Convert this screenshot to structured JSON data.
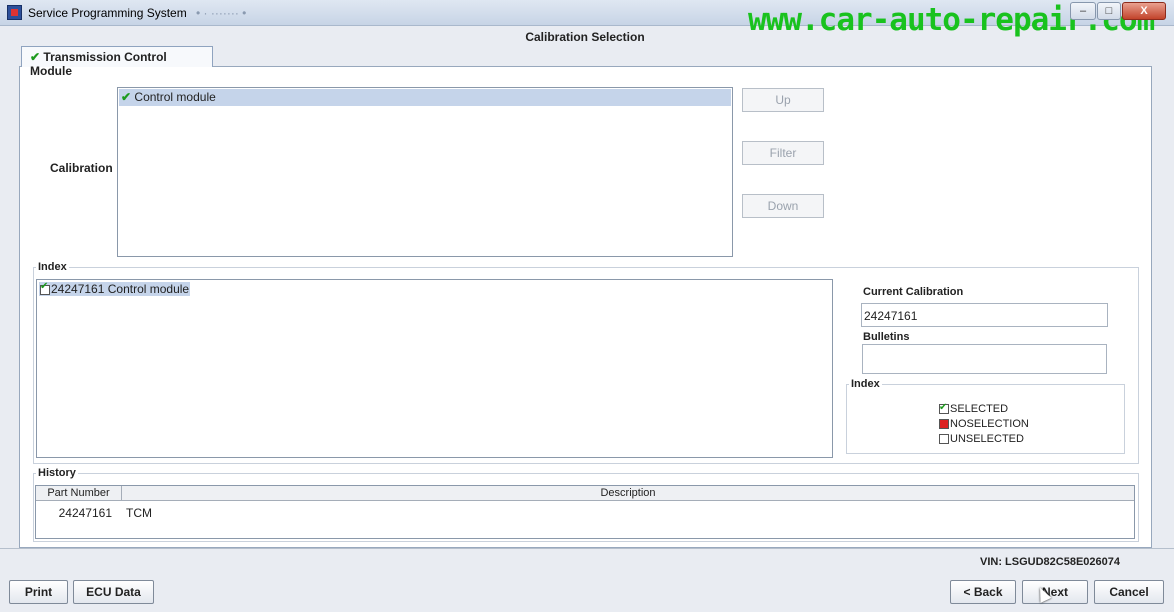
{
  "window": {
    "title": "Service Programming System",
    "ghost_title": "• · ······· •",
    "watermark": "www.car-auto-repair.com",
    "minimize_glyph": "–",
    "maximize_glyph": "□",
    "close_glyph": "X"
  },
  "header": {
    "title": "Calibration Selection",
    "tab_check": "✔",
    "tab_label": "Transmission Control Module"
  },
  "calibration": {
    "label": "Calibration",
    "item_check": "✔",
    "item": "Control module",
    "buttons": {
      "up": "Up",
      "filter": "Filter",
      "down": "Down"
    }
  },
  "index": {
    "group_title": "Index",
    "item": "24247161 Control module",
    "current_calibration_label": "Current Calibration",
    "current_calibration_value": "24247161",
    "bulletins_label": "Bulletins",
    "bulletins_value": "",
    "legend": {
      "title": "Index",
      "selected": "SELECTED",
      "noselection": "NOSELECTION",
      "unselected": "UNSELECTED"
    }
  },
  "history": {
    "title": "History",
    "columns": [
      "Part Number",
      "Description"
    ],
    "rows": [
      {
        "part_number": "24247161",
        "description": "TCM"
      }
    ]
  },
  "footer": {
    "vin": "VIN: LSGUD82C58E026074",
    "print": "Print",
    "ecu_data": "ECU Data",
    "back": "< Back",
    "next": "Next",
    "cancel": "Cancel"
  },
  "colors": {
    "accent_green": "#19c21e",
    "selection": "#c5d4ea"
  }
}
